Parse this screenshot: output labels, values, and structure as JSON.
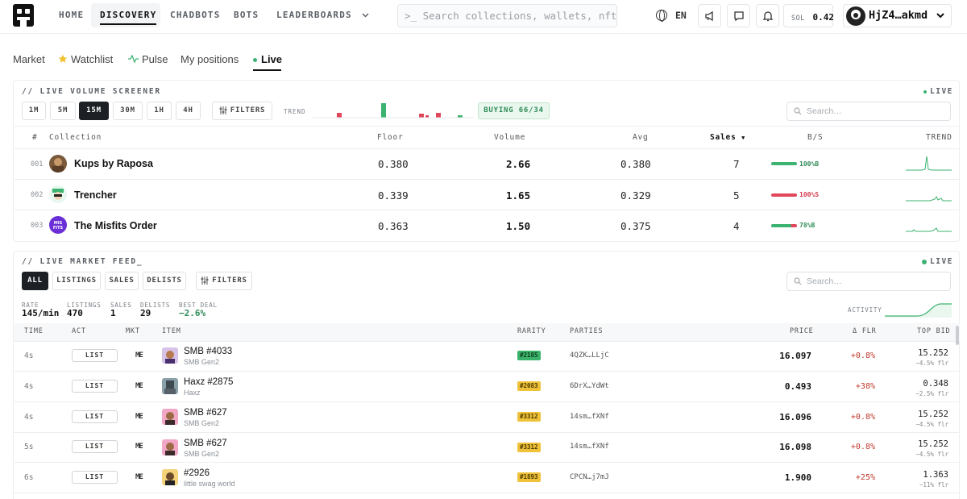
{
  "nav": {
    "items": [
      {
        "label": "HOME"
      },
      {
        "label": "DISCOVERY"
      },
      {
        "label": "CHADBOTS"
      },
      {
        "label": "BOTS"
      },
      {
        "label": "LEADERBOARDS"
      }
    ],
    "search_placeholder": ">_ Search collections, wallets, nfts",
    "language": "EN",
    "sol_label": "SOL",
    "sol_value": "0.42",
    "wallet": "HjZ4…akmd"
  },
  "subtabs": [
    {
      "label": "Market"
    },
    {
      "label": "Watchlist"
    },
    {
      "label": "Pulse"
    },
    {
      "label": "My positions"
    },
    {
      "label": "Live"
    }
  ],
  "screener": {
    "title": "// LIVE VOLUME SCREENER",
    "live": "LIVE",
    "timeframes": [
      "1M",
      "5M",
      "15M",
      "30M",
      "1H",
      "4H"
    ],
    "active_timeframe": "15M",
    "filters": "FILTERS",
    "trend_label": "TREND",
    "buying": "BUYING 66/34",
    "search_placeholder": "Search…",
    "columns": {
      "rank": "#",
      "collection": "Collection",
      "floor": "Floor",
      "volume": "Volume",
      "avg": "Avg",
      "sales": "Sales",
      "bs": "B/S",
      "trend": "TREND"
    },
    "rows": [
      {
        "rank": "001",
        "name": "Kups by Raposa",
        "floor": "0.380",
        "volume": "2.66",
        "avg": "0.380",
        "sales": "7",
        "bs": "100%B",
        "bs_pct": 1.0,
        "bs_color": "#3cb371"
      },
      {
        "rank": "002",
        "name": "Trencher",
        "floor": "0.339",
        "volume": "1.65",
        "avg": "0.329",
        "sales": "5",
        "bs": "100%S",
        "bs_pct": 1.0,
        "bs_color": "#e0475b"
      },
      {
        "rank": "003",
        "name": "The Misfits Order",
        "floor": "0.363",
        "volume": "1.50",
        "avg": "0.375",
        "sales": "4",
        "bs": "78%B",
        "bs_pct": 0.78,
        "bs_color": "#3cb371"
      }
    ]
  },
  "feed": {
    "title": "// LIVE MARKET FEED_",
    "live": "LIVE",
    "tabs": [
      "ALL",
      "LISTINGS",
      "SALES",
      "DELISTS"
    ],
    "active_tab": "ALL",
    "filters": "FILTERS",
    "search_placeholder": "Search…",
    "stats": [
      {
        "label": "RATE",
        "value": "145/min"
      },
      {
        "label": "LISTINGS",
        "value": "470"
      },
      {
        "label": "SALES",
        "value": "1"
      },
      {
        "label": "DELISTS",
        "value": "29"
      },
      {
        "label": "BEST DEAL",
        "value": "−2.6%"
      }
    ],
    "activity_label": "ACTIVITY",
    "columns": {
      "time": "TIME",
      "act": "ACT",
      "mkt": "MKT",
      "item": "ITEM",
      "rarity": "RARITY",
      "parties": "PARTIES",
      "price": "PRICE",
      "dflr": "Δ FLR",
      "topbid": "TOP BID"
    },
    "rows": [
      {
        "time": "4s",
        "act": "LIST",
        "mkt": "ME",
        "name": "SMB #4033",
        "collection": "SMB Gen2",
        "rarity": "#2185",
        "rarity_color": "green",
        "parties": "4QZK…LLjC",
        "price": "16.097",
        "dflr": "+0.8%",
        "topbid": "15.252",
        "topbid_sub": "−4.5% flr"
      },
      {
        "time": "4s",
        "act": "LIST",
        "mkt": "ME",
        "name": "Haxz #2875",
        "collection": "Haxz",
        "rarity": "#2083",
        "rarity_color": "yellow",
        "parties": "6DrX…YdWt",
        "price": "0.493",
        "dflr": "+38%",
        "topbid": "0.348",
        "topbid_sub": "−2.5% flr"
      },
      {
        "time": "4s",
        "act": "LIST",
        "mkt": "ME",
        "name": "SMB #627",
        "collection": "SMB Gen2",
        "rarity": "#3312",
        "rarity_color": "yellow",
        "parties": "14sm…fXNf",
        "price": "16.096",
        "dflr": "+0.8%",
        "topbid": "15.252",
        "topbid_sub": "−4.5% flr"
      },
      {
        "time": "5s",
        "act": "LIST",
        "mkt": "ME",
        "name": "SMB #627",
        "collection": "SMB Gen2",
        "rarity": "#3312",
        "rarity_color": "yellow",
        "parties": "14sm…fXNf",
        "price": "16.098",
        "dflr": "+0.8%",
        "topbid": "15.252",
        "topbid_sub": "−4.5% flr"
      },
      {
        "time": "6s",
        "act": "LIST",
        "mkt": "ME",
        "name": "#2926",
        "collection": "little swag world",
        "rarity": "#1893",
        "rarity_color": "yellow",
        "parties": "CPCN…j7mJ",
        "price": "1.900",
        "dflr": "+25%",
        "topbid": "1.363",
        "topbid_sub": "−11% flr"
      }
    ]
  },
  "colors": {
    "accent": "#1d2025",
    "buy": "#3cb371",
    "sell": "#e0475b",
    "positive_delta": "#c0392b"
  }
}
